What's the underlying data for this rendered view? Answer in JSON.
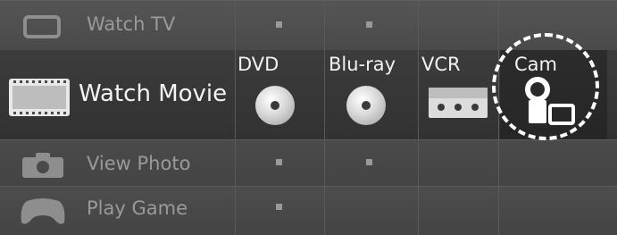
{
  "menu": {
    "categories": [
      {
        "id": "tv",
        "label": "Watch TV",
        "icon": "tv-icon",
        "selected": false
      },
      {
        "id": "movie",
        "label": "Watch Movie",
        "icon": "film-icon",
        "selected": true
      },
      {
        "id": "photo",
        "label": "View Photo",
        "icon": "camera-icon",
        "selected": false
      },
      {
        "id": "game",
        "label": "Play Game",
        "icon": "gamepad-icon",
        "selected": false
      }
    ],
    "movie_sources": [
      {
        "label": "DVD",
        "icon": "disc-icon"
      },
      {
        "label": "Blu-ray",
        "icon": "disc-icon"
      },
      {
        "label": "VCR",
        "icon": "tape-icon"
      },
      {
        "label": "Cam",
        "icon": "camcorder-icon",
        "focused": true
      }
    ]
  },
  "colors": {
    "background": "#3e3e3e",
    "selected_text": "#f4f4f4",
    "dim_text": "#9a9a9a",
    "focus_ring": "#ffffff"
  }
}
